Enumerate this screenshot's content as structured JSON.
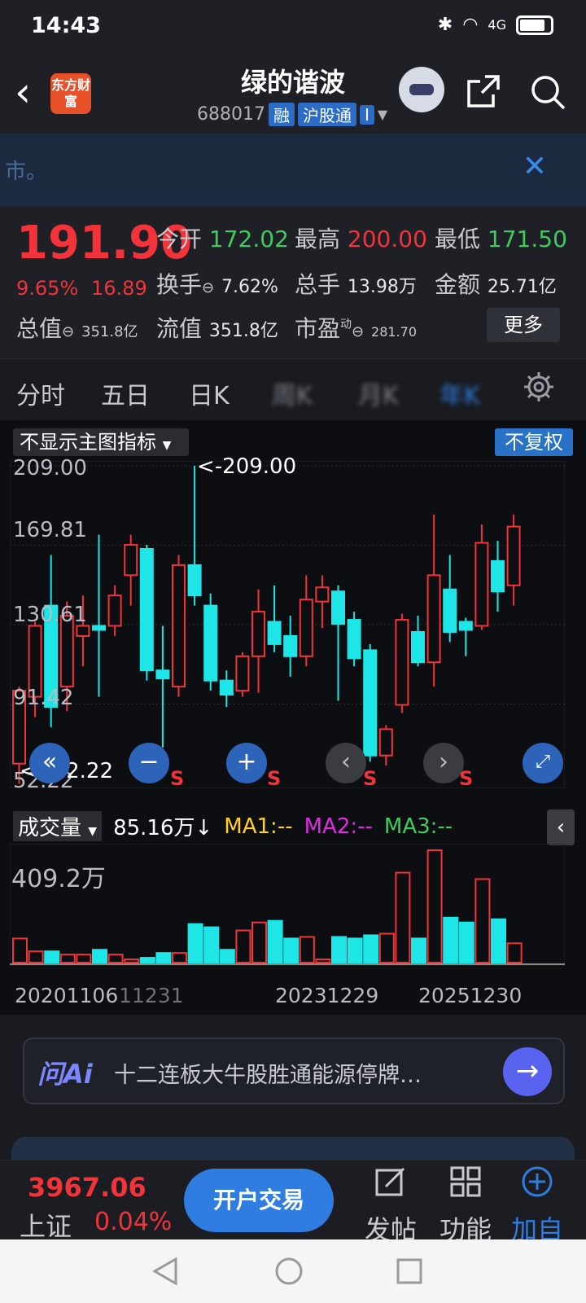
{
  "status_bar": {
    "time": "14:43",
    "network": "4G"
  },
  "header": {
    "logo_text": "东方财富",
    "title": "绿的谐波",
    "code": "688017",
    "tag_margin": "融",
    "tag_connect": "沪股通",
    "tag_more": "I"
  },
  "banner": {
    "text": "市。"
  },
  "quote": {
    "price": "191.90",
    "change_pct": "9.65%",
    "change_amt": "16.89",
    "open_label": "今开",
    "open": "172.02",
    "high_label": "最高",
    "high": "200.00",
    "low_label": "最低",
    "low": "171.50",
    "turnover_label": "换手",
    "turnover": "7.62%",
    "volume_label": "总手",
    "volume": "13.98万",
    "amount_label": "金额",
    "amount": "25.71亿",
    "mktcap_label": "总值",
    "mktcap": "351.8亿",
    "float_label": "流值",
    "float": "351.8亿",
    "pe_label": "市盈",
    "pe_sup": "动",
    "pe": "281.70",
    "more_label": "更多"
  },
  "tabs": [
    {
      "label": "分时"
    },
    {
      "label": "五日"
    },
    {
      "label": "日K"
    },
    {
      "label": "周K"
    },
    {
      "label": "月K"
    },
    {
      "label": "年K"
    }
  ],
  "chart": {
    "indicator_select": "不显示主图指标",
    "adjust_label": "不复权",
    "axis_labels": [
      "209.00",
      "169.81",
      "130.61",
      "91.42",
      "52.22"
    ],
    "max_note": "<-209.00",
    "min_note": "<--52.22",
    "sell_mark": "S"
  },
  "volume": {
    "select_label": "成交量",
    "current": "85.16万",
    "arrow": "↓",
    "ma1": "MA1:--",
    "ma2": "MA2:--",
    "ma3": "MA3:--",
    "max_label": "409.2万"
  },
  "dates": [
    "20201106",
    "11231",
    "20231229",
    "20251230"
  ],
  "ai": {
    "logo": "问Ai",
    "text": "十二连板大牛股胜通能源停牌…"
  },
  "bottom": {
    "index_value": "3967.06",
    "index_name": "上证",
    "index_pct": "0.04%",
    "trade_label": "开户交易",
    "post_label": "发帖",
    "func_label": "功能",
    "add_label": "加自"
  },
  "colors": {
    "up": "#f2333a",
    "down": "#1ee6e6",
    "accent": "#2f7de0",
    "green": "#3dcc5e"
  },
  "chart_data": {
    "type": "candlestick",
    "ylim": [
      52.22,
      209.0
    ],
    "candles": [
      {
        "o": 62,
        "c": 98,
        "h": 100,
        "l": 52
      },
      {
        "o": 95,
        "c": 130,
        "h": 132,
        "l": 85
      },
      {
        "o": 140,
        "c": 90,
        "h": 165,
        "l": 80
      },
      {
        "o": 100,
        "c": 135,
        "h": 142,
        "l": 88
      },
      {
        "o": 125,
        "c": 130,
        "h": 145,
        "l": 110
      },
      {
        "o": 130,
        "c": 128,
        "h": 175,
        "l": 95
      },
      {
        "o": 130,
        "c": 145,
        "h": 150,
        "l": 125
      },
      {
        "o": 155,
        "c": 170,
        "h": 175,
        "l": 140
      },
      {
        "o": 168,
        "c": 108,
        "h": 170,
        "l": 103
      },
      {
        "o": 108,
        "c": 104,
        "h": 130,
        "l": 70
      },
      {
        "o": 100,
        "c": 160,
        "h": 165,
        "l": 95
      },
      {
        "o": 160,
        "c": 145,
        "h": 209,
        "l": 140
      },
      {
        "o": 140,
        "c": 103,
        "h": 146,
        "l": 98
      },
      {
        "o": 103,
        "c": 96,
        "h": 108,
        "l": 90
      },
      {
        "o": 98,
        "c": 115,
        "h": 117,
        "l": 95
      },
      {
        "o": 115,
        "c": 137,
        "h": 148,
        "l": 97
      },
      {
        "o": 132,
        "c": 121,
        "h": 150,
        "l": 117
      },
      {
        "o": 125,
        "c": 115,
        "h": 135,
        "l": 105
      },
      {
        "o": 115,
        "c": 143,
        "h": 155,
        "l": 110
      },
      {
        "o": 142,
        "c": 149,
        "h": 155,
        "l": 129
      },
      {
        "o": 147,
        "c": 131,
        "h": 150,
        "l": 93
      },
      {
        "o": 133,
        "c": 114,
        "h": 137,
        "l": 110
      },
      {
        "o": 118,
        "c": 66,
        "h": 121,
        "l": 63
      },
      {
        "o": 66,
        "c": 79,
        "h": 81,
        "l": 61
      },
      {
        "o": 91,
        "c": 133,
        "h": 136,
        "l": 87
      },
      {
        "o": 127,
        "c": 112,
        "h": 135,
        "l": 110
      },
      {
        "o": 112,
        "c": 155,
        "h": 185,
        "l": 100
      },
      {
        "o": 148,
        "c": 127,
        "h": 165,
        "l": 122
      },
      {
        "o": 132,
        "c": 128,
        "h": 134,
        "l": 115
      },
      {
        "o": 130,
        "c": 171,
        "h": 180,
        "l": 128
      },
      {
        "o": 162,
        "c": 147,
        "h": 172,
        "l": 137
      },
      {
        "o": 150,
        "c": 179,
        "h": 185,
        "l": 140
      }
    ],
    "volumes": [
      15,
      7,
      7,
      5,
      5,
      8,
      5,
      2,
      3,
      6,
      6,
      24,
      22,
      8,
      20,
      25,
      26,
      15,
      16,
      2,
      16,
      15,
      17,
      18,
      56,
      15,
      70,
      28,
      25,
      52,
      27,
      12
    ],
    "volume_max": 409.2,
    "volume_unit": "万"
  }
}
